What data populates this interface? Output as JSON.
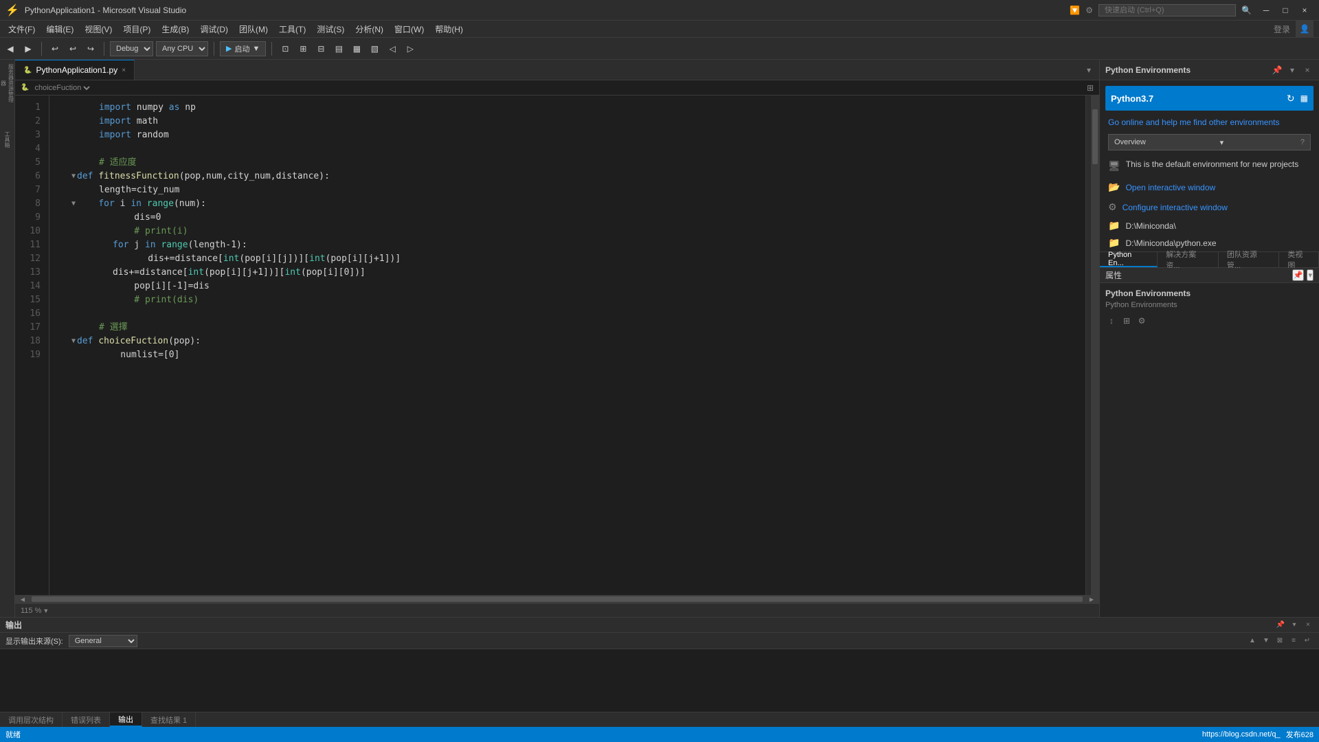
{
  "titlebar": {
    "icon": "VS",
    "title": "PythonApplication1 - Microsoft Visual Studio",
    "search_placeholder": "快速启动 (Ctrl+Q)",
    "min_label": "─",
    "max_label": "□",
    "close_label": "×"
  },
  "menubar": {
    "items": [
      {
        "label": "文件(F)"
      },
      {
        "label": "编辑(E)"
      },
      {
        "label": "视图(V)"
      },
      {
        "label": "项目(P)"
      },
      {
        "label": "生成(B)"
      },
      {
        "label": "调试(D)"
      },
      {
        "label": "团队(M)"
      },
      {
        "label": "工具(T)"
      },
      {
        "label": "测试(S)"
      },
      {
        "label": "分析(N)"
      },
      {
        "label": "窗口(W)"
      },
      {
        "label": "帮助(H)"
      }
    ]
  },
  "toolbar": {
    "debug_config": "Debug",
    "cpu_config": "Any CPU",
    "start_label": "启动",
    "login_label": "登录"
  },
  "tabs": {
    "active_tab": "PythonApplication1.py",
    "active_tab_modified": false
  },
  "code_nav": {
    "breadcrumb": "choiceFuction"
  },
  "code": {
    "lines": [
      {
        "num": 1,
        "text": "    import numpy as np",
        "tokens": [
          {
            "t": "kw",
            "v": "import"
          },
          {
            "t": "op",
            "v": " numpy "
          },
          {
            "t": "kw",
            "v": "as"
          },
          {
            "t": "op",
            "v": " np"
          }
        ]
      },
      {
        "num": 2,
        "text": "    import math",
        "tokens": [
          {
            "t": "kw",
            "v": "import"
          },
          {
            "t": "op",
            "v": " math"
          }
        ]
      },
      {
        "num": 3,
        "text": "    import random",
        "tokens": [
          {
            "t": "kw",
            "v": "import"
          },
          {
            "t": "op",
            "v": " random"
          }
        ]
      },
      {
        "num": 4,
        "text": ""
      },
      {
        "num": 5,
        "text": "    # 适应度",
        "tokens": [
          {
            "t": "cmt",
            "v": "    # 适应度"
          }
        ]
      },
      {
        "num": 6,
        "text": "  def fitnessFunction(pop,num,city_num,distance):",
        "tokens": [
          {
            "t": "fold",
            "v": "▼"
          },
          {
            "t": "kw",
            "v": "def"
          },
          {
            "t": "fn",
            "v": " fitnessFunction"
          },
          {
            "t": "op",
            "v": "(pop,num,city_num,distance):"
          }
        ],
        "foldable": true
      },
      {
        "num": 7,
        "text": "        length=city_num",
        "tokens": [
          {
            "t": "op",
            "v": "        length=city_num"
          }
        ]
      },
      {
        "num": 8,
        "text": "    for i in range(num):",
        "tokens": [
          {
            "t": "fold",
            "v": "▼"
          },
          {
            "t": "op",
            "v": "    "
          },
          {
            "t": "kw",
            "v": "for"
          },
          {
            "t": "op",
            "v": " i "
          },
          {
            "t": "kw",
            "v": "in"
          },
          {
            "t": "op",
            "v": " "
          },
          {
            "t": "builtin",
            "v": "range"
          },
          {
            "t": "op",
            "v": "(num):"
          }
        ],
        "foldable": true,
        "indent": 1
      },
      {
        "num": 9,
        "text": "            dis=0",
        "tokens": [
          {
            "t": "op",
            "v": "            dis=0"
          }
        ]
      },
      {
        "num": 10,
        "text": "            # print(i)",
        "tokens": [
          {
            "t": "cmt",
            "v": "            # print(i)"
          }
        ]
      },
      {
        "num": 11,
        "text": "            for j in range(length-1):",
        "tokens": [
          {
            "t": "op",
            "v": "            "
          },
          {
            "t": "kw",
            "v": "for"
          },
          {
            "t": "op",
            "v": " j "
          },
          {
            "t": "kw",
            "v": "in"
          },
          {
            "t": "op",
            "v": " "
          },
          {
            "t": "builtin",
            "v": "range"
          },
          {
            "t": "op",
            "v": "(length-1):"
          }
        ]
      },
      {
        "num": 12,
        "text": "                dis+=distance[int(pop[i][j])][int(pop[i][j+1])]",
        "tokens": [
          {
            "t": "op",
            "v": "                dis+=distance["
          },
          {
            "t": "builtin",
            "v": "int"
          },
          {
            "t": "op",
            "v": "(pop[i][j])]["
          },
          {
            "t": "builtin",
            "v": "int"
          },
          {
            "t": "op",
            "v": "(pop[i][j+1])]"
          }
        ]
      },
      {
        "num": 13,
        "text": "            dis+=distance[int(pop[i][j+1])][int(pop[i][0])]",
        "tokens": [
          {
            "t": "op",
            "v": "            dis+=distance["
          },
          {
            "t": "builtin",
            "v": "int"
          },
          {
            "t": "op",
            "v": "(pop[i][j+1])]["
          },
          {
            "t": "builtin",
            "v": "int"
          },
          {
            "t": "op",
            "v": "(pop[i][0])]"
          }
        ]
      },
      {
        "num": 14,
        "text": "            pop[i][-1]=dis",
        "tokens": [
          {
            "t": "op",
            "v": "            pop[i][-1]=dis"
          }
        ]
      },
      {
        "num": 15,
        "text": "            # print(dis)",
        "tokens": [
          {
            "t": "cmt",
            "v": "            # print(dis)"
          }
        ]
      },
      {
        "num": 16,
        "text": ""
      },
      {
        "num": 17,
        "text": "    # 選擇",
        "tokens": [
          {
            "t": "cmt",
            "v": "    # 選擇"
          }
        ]
      },
      {
        "num": 18,
        "text": "  def choiceFuction(pop):",
        "tokens": [
          {
            "t": "fold",
            "v": "▼"
          },
          {
            "t": "kw",
            "v": "def"
          },
          {
            "t": "fn",
            "v": " choiceFuction"
          },
          {
            "t": "op",
            "v": "(pop):"
          }
        ],
        "foldable": true
      },
      {
        "num": 19,
        "text": "        numlist=[0]",
        "tokens": [
          {
            "t": "op",
            "v": "        numlist=[0]"
          }
        ]
      }
    ]
  },
  "zoom": {
    "value": "115 %"
  },
  "python_environments": {
    "panel_title": "Python Environments",
    "version": "Python3.7",
    "go_online_label": "Go online and help me find other environments",
    "overview_label": "Overview",
    "help_icon": "?",
    "default_env_text": "This is the default environment for new projects",
    "open_interactive_label": "Open interactive window",
    "configure_interactive_label": "Configure interactive window",
    "path1": "D:\\Miniconda\\",
    "path2": "D:\\Miniconda\\python.exe",
    "tabs": [
      {
        "label": "Python En...",
        "active": true
      },
      {
        "label": "解决方案资..."
      },
      {
        "label": "团队资源管..."
      },
      {
        "label": "类视图"
      }
    ]
  },
  "attributes_panel": {
    "title": "属性",
    "props_title": "Python Environments",
    "props_subtitle": "Python Environments"
  },
  "output_panel": {
    "title": "输出",
    "filter_label": "显示输出来源(S):",
    "filter_value": "General"
  },
  "bottom_tabs": [
    {
      "label": "调用层次结构"
    },
    {
      "label": "错误列表"
    },
    {
      "label": "输出",
      "active": true
    },
    {
      "label": "查找结果 1"
    }
  ],
  "status_bar": {
    "left_items": [
      "就绪"
    ],
    "right_items": [
      "https://blog.csdn.net/q_",
      "发布628"
    ]
  }
}
